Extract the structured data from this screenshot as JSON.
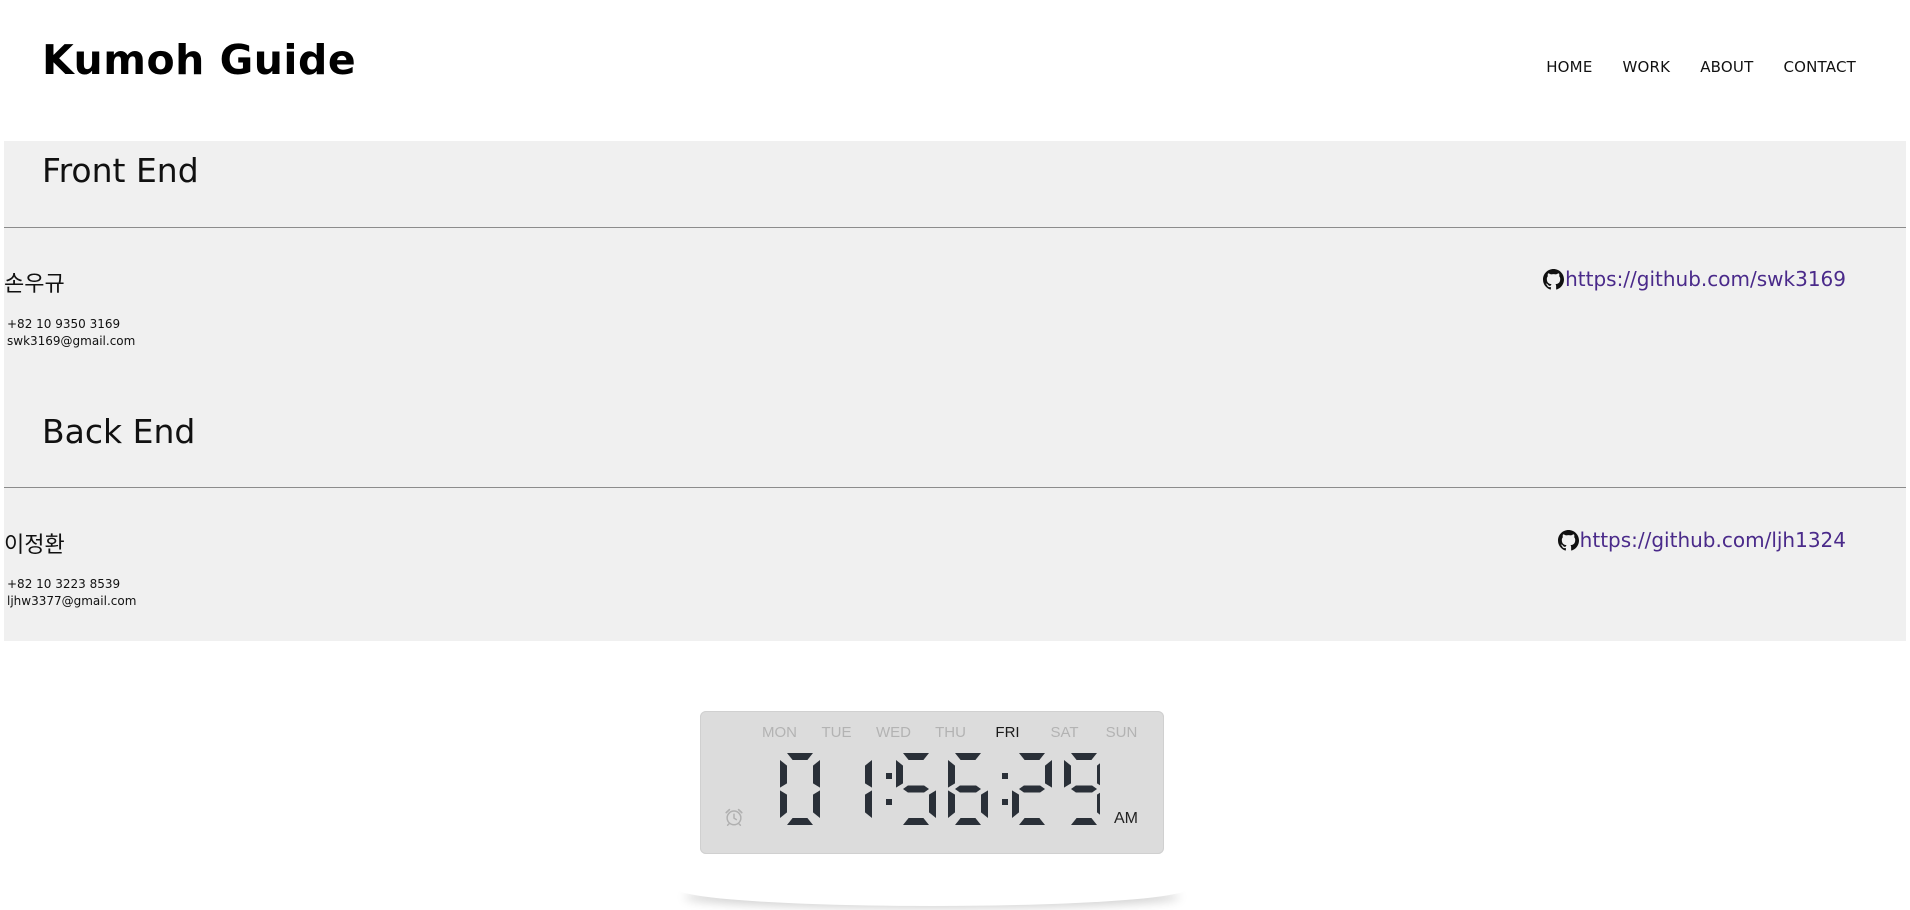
{
  "header": {
    "brand": "Kumoh Guide",
    "nav": [
      "HOME",
      "WORK",
      "ABOUT",
      "CONTACT"
    ]
  },
  "sections": [
    {
      "title": "Front End",
      "member": {
        "name": "손우규",
        "phone": "+82 10 9350 3169",
        "email": "swk3169@gmail.com",
        "github": "https://github.com/swk3169"
      }
    },
    {
      "title": "Back End",
      "member": {
        "name": "이정환",
        "phone": "+82 10 3223 8539",
        "email": "ljhw3377@gmail.com",
        "github": "https://github.com/ljh1324"
      }
    }
  ],
  "clock": {
    "days": [
      "MON",
      "TUE",
      "WED",
      "THU",
      "FRI",
      "SAT",
      "SUN"
    ],
    "active_day": "FRI",
    "time": "01:56:29",
    "ampm": "AM",
    "alarm_icon": "alarm-clock-icon"
  },
  "colors": {
    "panel_bg": "#f0f0f0",
    "link": "#4a2a8a",
    "clock_bg": "#dcdcdc",
    "digit": "#2a3038",
    "day_inactive": "#b3b3b3"
  }
}
